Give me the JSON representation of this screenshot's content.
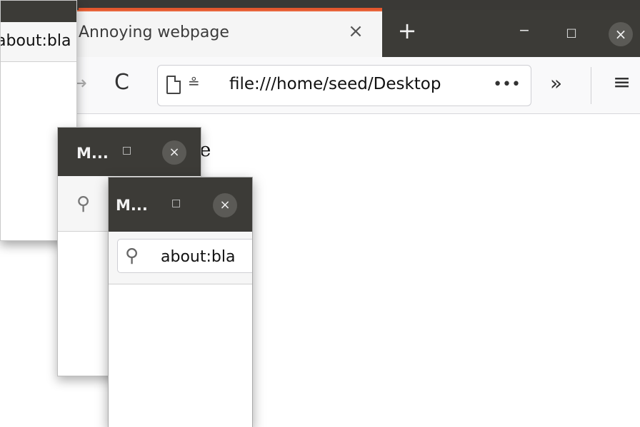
{
  "main_window": {
    "tab_title": "Annoying webpage",
    "icons": {
      "tab_close": "×",
      "new_tab": "+",
      "minimize": "‒",
      "maximize": "□",
      "close": "×",
      "back": "→",
      "reload": "C",
      "permissions": "≗",
      "page_actions": "•••",
      "overflow": "»",
      "menu": "≡"
    },
    "url": "file:///home/seed/Desktop",
    "page_text": "where"
  },
  "popups": [
    {
      "url_text": "about:bla"
    },
    {
      "title": "M...",
      "maximize": "□",
      "close": "×",
      "search_icon": "⚲"
    },
    {
      "title": "M...",
      "maximize": "□",
      "close": "×",
      "search_icon": "⚲",
      "url_text": "about:bla"
    }
  ],
  "colors": {
    "titlebar": "#3c3b37",
    "tab_accent": "#e9663c",
    "toolbar": "#f9f9fa"
  }
}
